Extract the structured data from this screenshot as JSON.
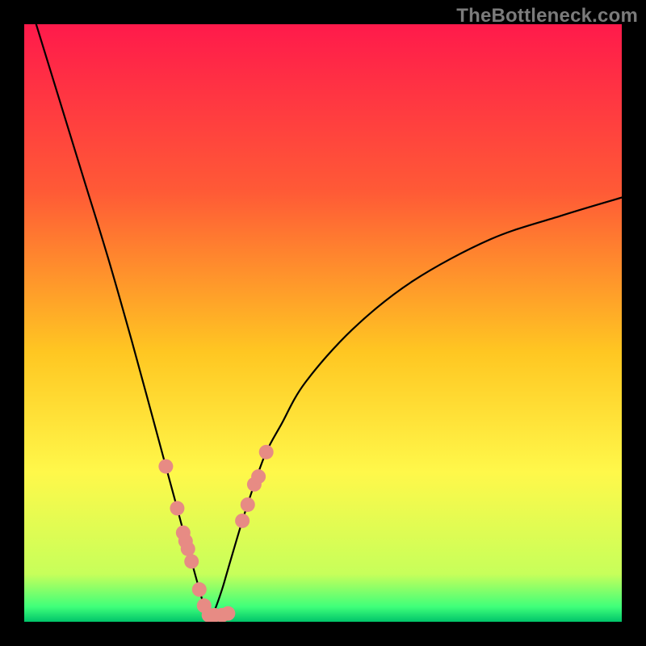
{
  "watermark": "TheBottleneck.com",
  "chart_data": {
    "type": "line",
    "title": "",
    "xlabel": "",
    "ylabel": "",
    "xlim": [
      0,
      100
    ],
    "ylim": [
      0,
      100
    ],
    "grid": false,
    "legend": false,
    "background_gradient_stops": [
      {
        "offset": 0,
        "color": "#ff1a4b"
      },
      {
        "offset": 0.28,
        "color": "#ff5a36"
      },
      {
        "offset": 0.55,
        "color": "#ffc722"
      },
      {
        "offset": 0.75,
        "color": "#fff84a"
      },
      {
        "offset": 0.92,
        "color": "#c7ff5a"
      },
      {
        "offset": 0.975,
        "color": "#3fff7a"
      },
      {
        "offset": 1.0,
        "color": "#00c46a"
      }
    ],
    "curve": {
      "comment": "V-shaped bottleneck curve. x = component balance (0-100), y = bottleneck % (0-100). Minimum ~ x=31.",
      "x": [
        2,
        6,
        10,
        14,
        18,
        21,
        23.7,
        25.6,
        27.4,
        28.0,
        29.3,
        30.1,
        31,
        31.8,
        33.1,
        34.1,
        36.5,
        38.5,
        40.5,
        43,
        47,
        55,
        65,
        78,
        90,
        100
      ],
      "y": [
        100,
        87,
        74,
        61,
        47,
        36,
        26,
        19,
        12.2,
        10.1,
        5.4,
        2.7,
        0.8,
        1.8,
        5.4,
        8.8,
        16.9,
        23.0,
        28.4,
        33,
        40,
        49,
        57,
        64,
        68,
        71
      ]
    },
    "markers": {
      "comment": "Salmon dots along lower portion of curve — benchmarked hardware configurations.",
      "color": "#e78b84",
      "radius_px": 9,
      "points": [
        {
          "x": 23.7,
          "y": 26.0
        },
        {
          "x": 25.6,
          "y": 19.0
        },
        {
          "x": 26.6,
          "y": 14.9
        },
        {
          "x": 27.0,
          "y": 13.5
        },
        {
          "x": 27.4,
          "y": 12.2
        },
        {
          "x": 28.0,
          "y": 10.1
        },
        {
          "x": 29.3,
          "y": 5.4
        },
        {
          "x": 30.1,
          "y": 2.7
        },
        {
          "x": 30.9,
          "y": 1.1
        },
        {
          "x": 31.8,
          "y": 1.1
        },
        {
          "x": 33.1,
          "y": 1.1
        },
        {
          "x": 34.1,
          "y": 1.4
        },
        {
          "x": 36.5,
          "y": 16.9
        },
        {
          "x": 37.4,
          "y": 19.6
        },
        {
          "x": 38.5,
          "y": 23.0
        },
        {
          "x": 39.2,
          "y": 24.3
        },
        {
          "x": 40.5,
          "y": 28.4
        }
      ]
    }
  }
}
